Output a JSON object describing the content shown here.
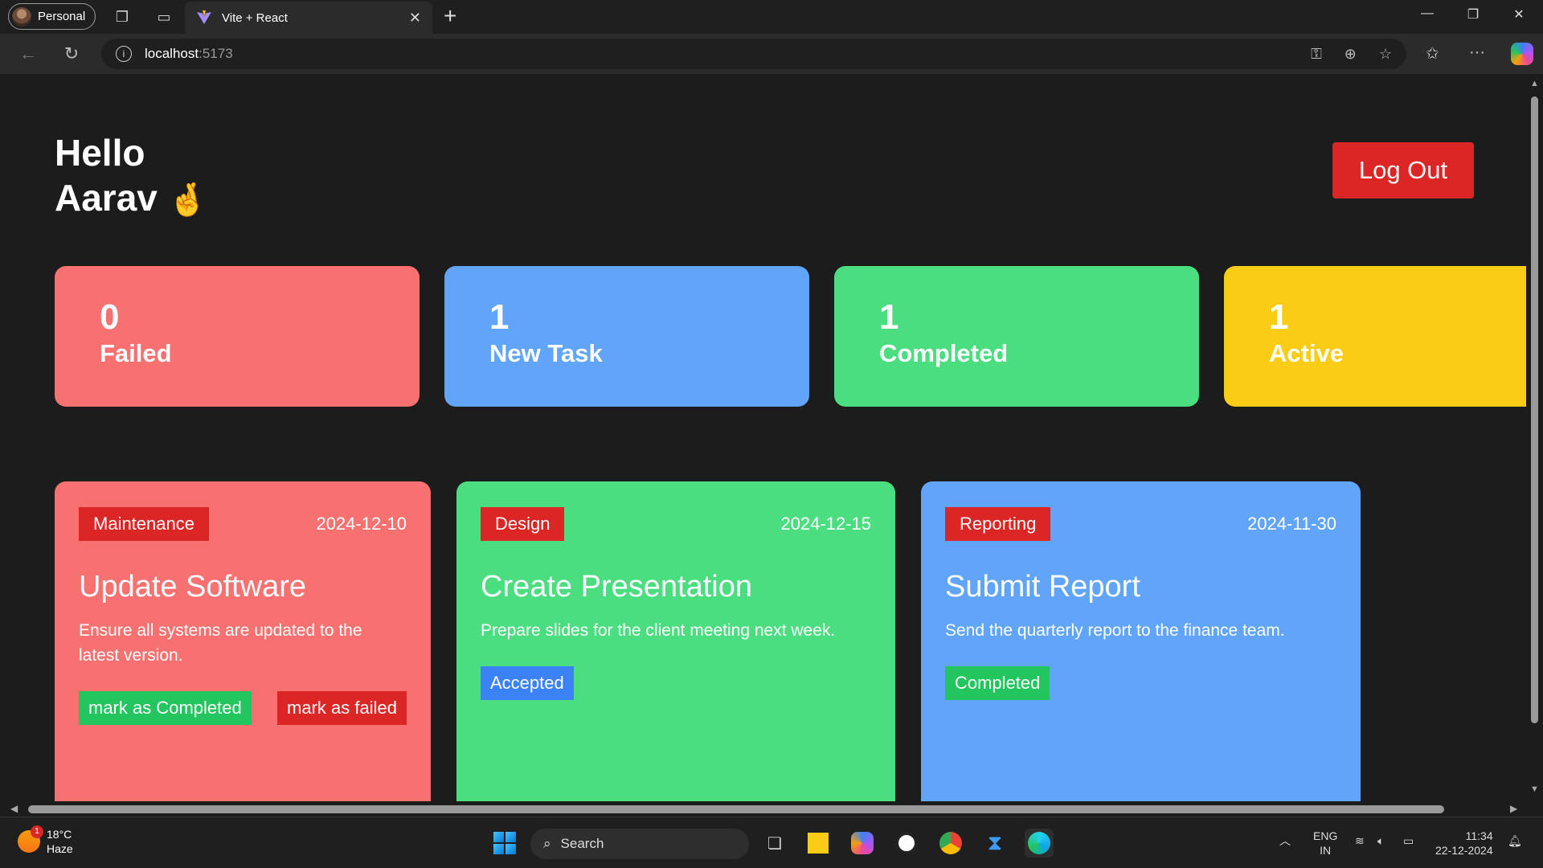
{
  "browser": {
    "profile_label": "Personal",
    "tab_title": "Vite + React",
    "url_host": "localhost",
    "url_port": ":5173"
  },
  "page": {
    "greeting_line1": "Hello",
    "greeting_name": "Aarav",
    "greeting_emoji": "🤞",
    "logout_label": "Log Out",
    "stats": [
      {
        "count": "0",
        "label": "Failed",
        "color": "#f87171"
      },
      {
        "count": "1",
        "label": "New Task",
        "color": "#60a5fa"
      },
      {
        "count": "1",
        "label": "Completed",
        "color": "#4ade80"
      },
      {
        "count": "1",
        "label": "Active",
        "color": "#facc15"
      }
    ],
    "tasks": [
      {
        "category": "Maintenance",
        "date": "2024-12-10",
        "title": "Update Software",
        "description": "Ensure all systems are updated to the latest version.",
        "actions": [
          "mark as Completed",
          "mark as failed"
        ],
        "color": "#f87171"
      },
      {
        "category": "Design",
        "date": "2024-12-15",
        "title": "Create Presentation",
        "description": "Prepare slides for the client meeting next week.",
        "status": "Accepted",
        "color": "#4ade80"
      },
      {
        "category": "Reporting",
        "date": "2024-11-30",
        "title": "Submit Report",
        "description": "Send the quarterly report to the finance team.",
        "status": "Completed",
        "color": "#60a5fa"
      }
    ]
  },
  "taskbar": {
    "weather_temp": "18°C",
    "weather_desc": "Haze",
    "weather_badge": "1",
    "search_label": "Search",
    "lang_line1": "ENG",
    "lang_line2": "IN",
    "time": "11:34",
    "date": "22-12-2024"
  }
}
